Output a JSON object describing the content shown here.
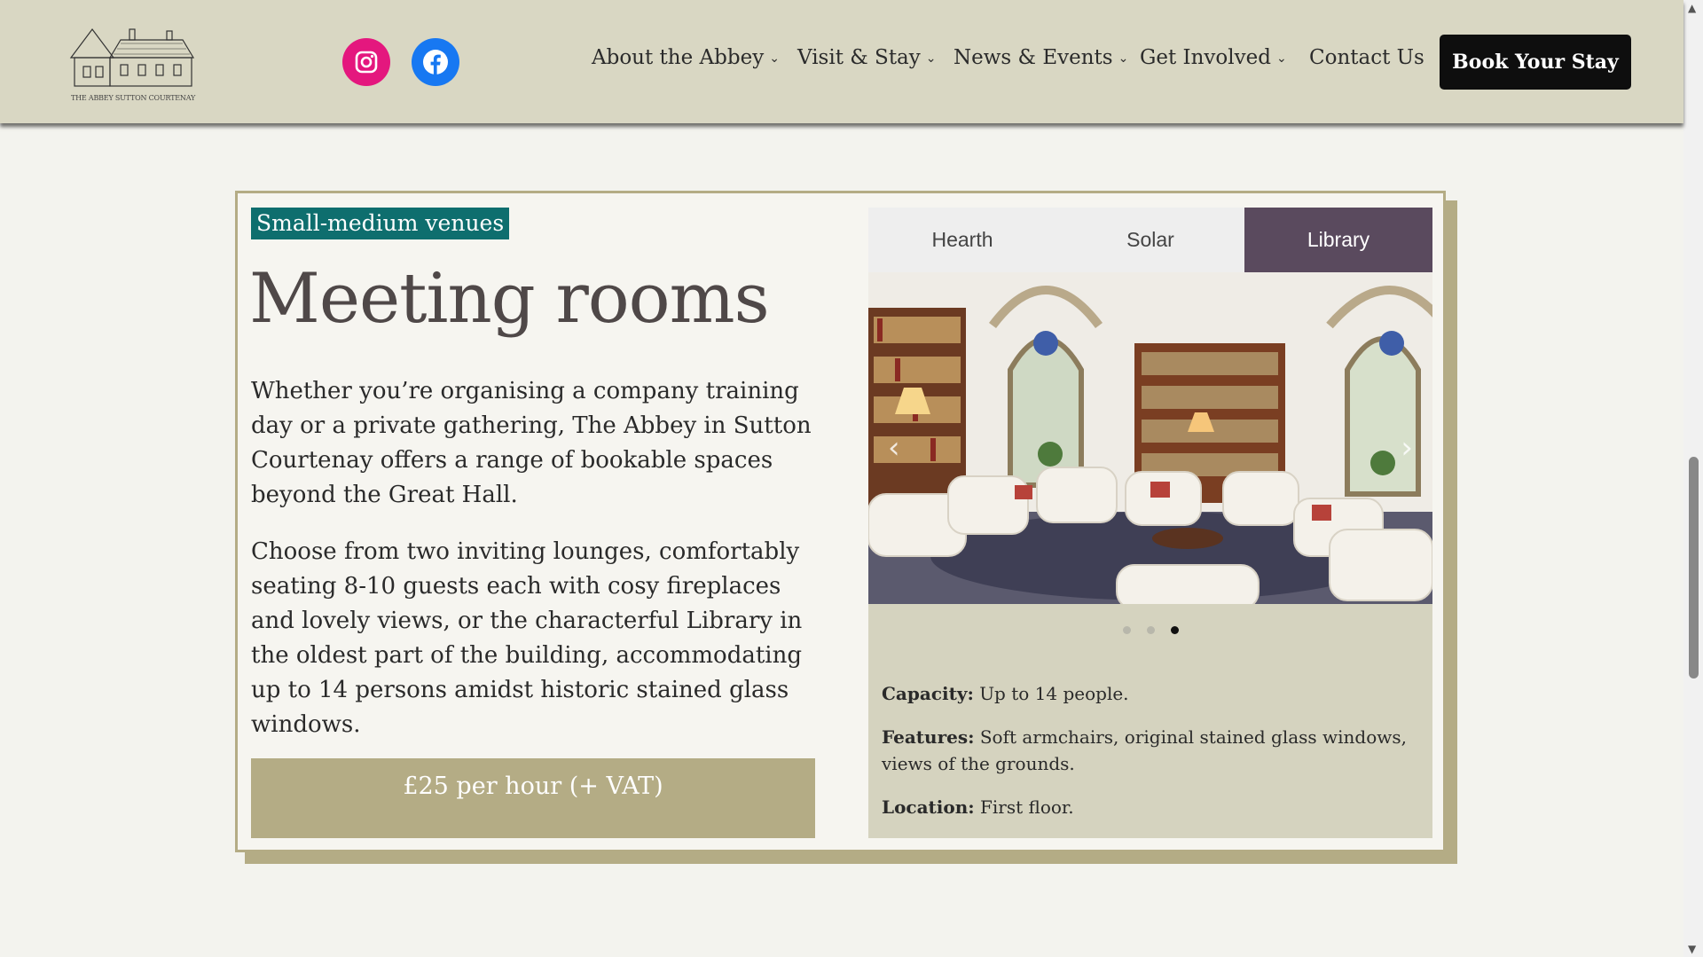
{
  "header": {
    "logo_text": "THE ABBEY SUTTON COURTENAY",
    "social": [
      "instagram-icon",
      "facebook-icon"
    ],
    "nav": [
      {
        "label": "About the Abbey",
        "dropdown": true
      },
      {
        "label": "Visit & Stay",
        "dropdown": true
      },
      {
        "label": "News & Events",
        "dropdown": true
      },
      {
        "label": "Get Involved",
        "dropdown": true
      },
      {
        "label": "Contact Us",
        "dropdown": false
      }
    ],
    "cta": "Book Your Stay"
  },
  "section": {
    "tag": "Small-medium venues",
    "title": "Meeting rooms",
    "paragraph_1": "Whether you’re organising a company training day or a private gathering, The Abbey in Sutton Courtenay offers a range of bookable spaces beyond the Great Hall.",
    "paragraph_2": "Choose from two inviting lounges, comfortably seating 8-10 guests each with cosy fireplaces and lovely views, or the characterful Library in the oldest part of the building, accommodating up to 14 persons amidst historic stained glass windows.",
    "price": "£25 per hour (+ VAT)"
  },
  "rooms": {
    "tabs": [
      "Hearth",
      "Solar",
      "Library"
    ],
    "active_tab": "Library",
    "slides_total": 3,
    "active_slide": 3,
    "details": {
      "capacity_label": "Capacity:",
      "capacity_value": "Up to 14 people.",
      "features_label": "Features:",
      "features_value": "Soft armchairs, original stained glass windows, views of the grounds.",
      "location_label": "Location:",
      "location_value": "First floor."
    }
  },
  "colors": {
    "header_bg": "#d9d7c3",
    "accent_olive": "#b4ac85",
    "tag_teal": "#0e6e6e",
    "active_tab": "#5a4a5e",
    "instagram": "#e4177e",
    "facebook": "#1778f2"
  }
}
